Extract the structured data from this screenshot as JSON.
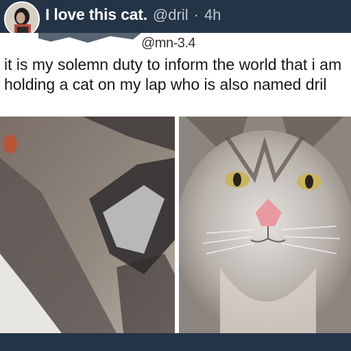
{
  "header": {
    "display_name": "I love this cat.",
    "handle": "@dril",
    "separator": "·",
    "time": "4h"
  },
  "quoted_fragment": {
    "text": "@mn-3.4"
  },
  "tweet": {
    "text": "it is my solemn duty to inform the world that i am holding a cat on my lap who is also named dril"
  },
  "media": {
    "images": [
      {
        "icon": "cat-lap-photo"
      },
      {
        "icon": "cat-face-photo"
      }
    ]
  },
  "colors": {
    "header_bg": "#243447",
    "text_primary": "#14171a",
    "text_secondary": "#bfc7cf"
  }
}
